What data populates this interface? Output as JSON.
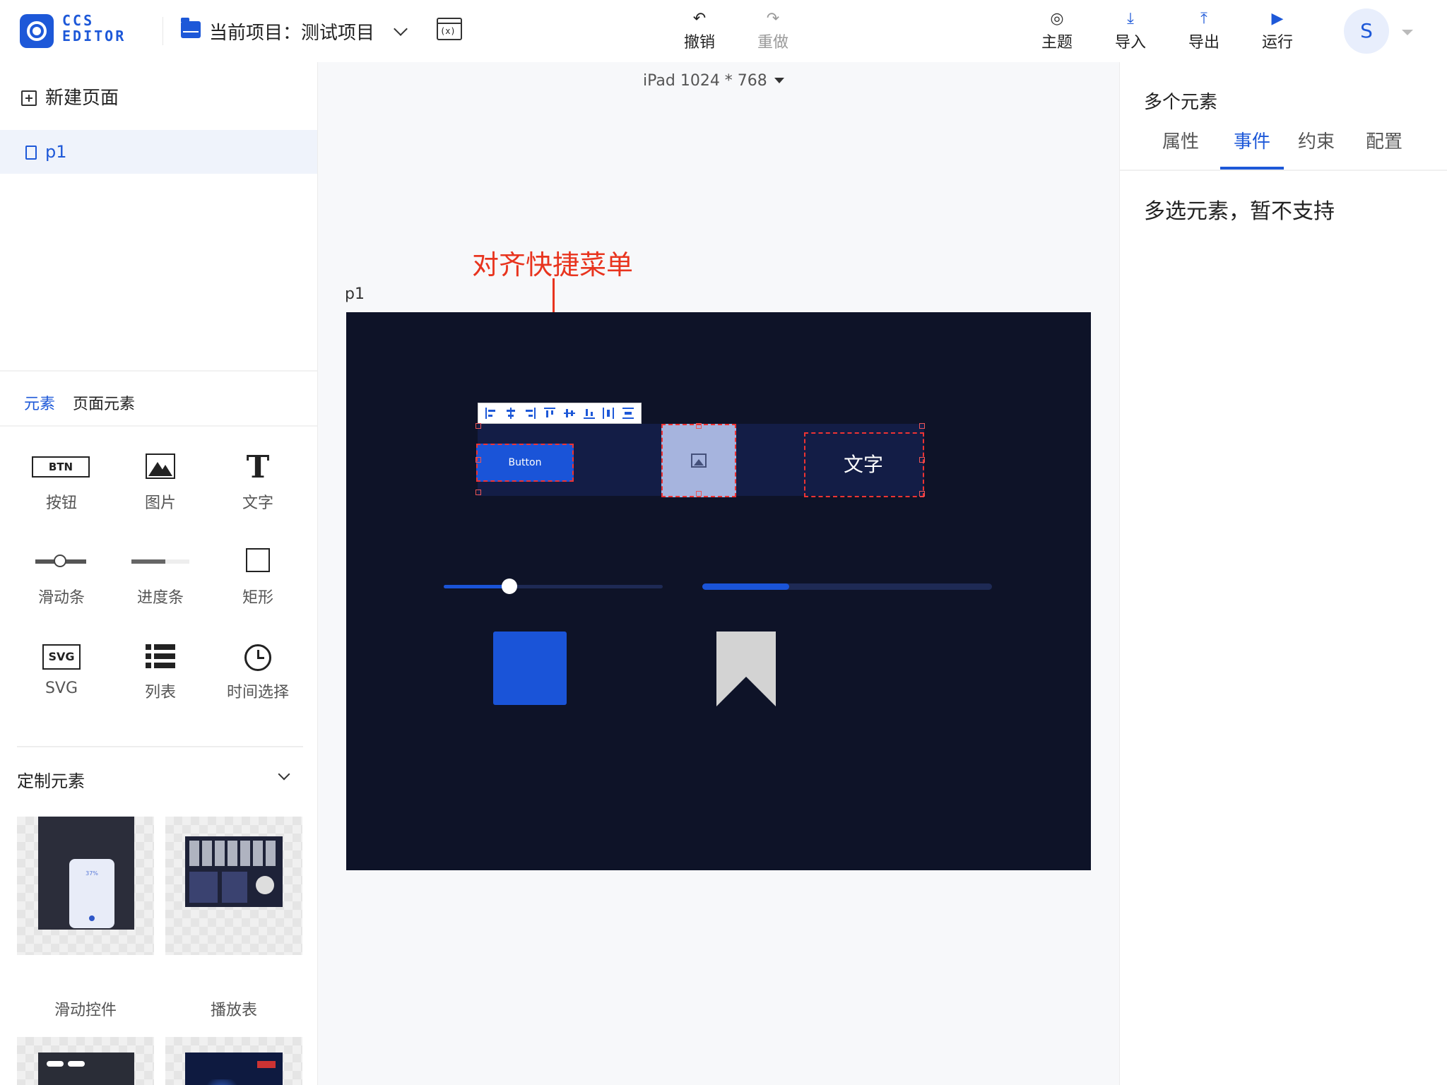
{
  "header": {
    "brand_line1": "CCS",
    "brand_line2": "EDITOR",
    "project_label": "当前项目：测试项目",
    "variable_icon_text": "(x)",
    "undo_label": "撤销",
    "redo_label": "重做",
    "theme_label": "主题",
    "import_label": "导入",
    "export_label": "导出",
    "run_label": "运行",
    "avatar_letter": "S"
  },
  "left_panel": {
    "new_page_label": "新建页面",
    "pages": [
      "p1"
    ],
    "tabs": [
      {
        "label": "元素",
        "active": true
      },
      {
        "label": "页面元素",
        "active": false
      }
    ],
    "widgets": [
      {
        "label": "按钮",
        "icon": "button-icon",
        "icon_text": "BTN"
      },
      {
        "label": "图片",
        "icon": "image-icon"
      },
      {
        "label": "文字",
        "icon": "text-icon",
        "icon_text": "T"
      },
      {
        "label": "滑动条",
        "icon": "slider-icon"
      },
      {
        "label": "进度条",
        "icon": "progress-icon"
      },
      {
        "label": "矩形",
        "icon": "rectangle-icon"
      },
      {
        "label": "SVG",
        "icon": "svg-icon",
        "icon_text": "SVG"
      },
      {
        "label": "列表",
        "icon": "list-icon"
      },
      {
        "label": "时间选择",
        "icon": "clock-icon"
      }
    ],
    "custom_section_title": "定制元素",
    "custom_elements": [
      {
        "label": "滑动控件",
        "thumb_text": "37%"
      },
      {
        "label": "播放表"
      },
      {
        "label": ""
      },
      {
        "label": ""
      }
    ]
  },
  "canvas_area": {
    "device_label": "iPad 1024 * 768",
    "annotation": "对齐快捷菜单",
    "page_name": "p1",
    "canvas_bg": "#0e1328",
    "accent": "#1a54d8",
    "button_text": "Button",
    "text_element": "文字",
    "slider_value": 0.3,
    "progress_value": 0.3
  },
  "right_panel": {
    "title": "多个元素",
    "tabs": [
      {
        "label": "属性",
        "active": false
      },
      {
        "label": "事件",
        "active": true
      },
      {
        "label": "约束",
        "active": false
      },
      {
        "label": "配置",
        "active": false
      }
    ],
    "message": "多选元素，暂不支持"
  }
}
